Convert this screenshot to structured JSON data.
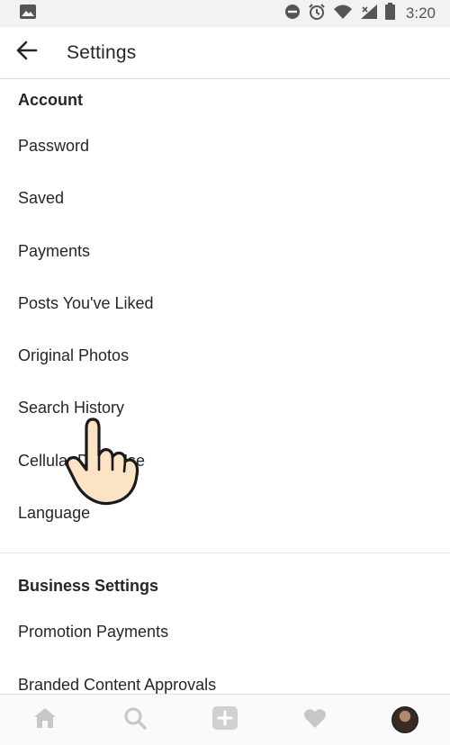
{
  "status_bar": {
    "time": "3:20",
    "icons": [
      "image-icon",
      "do-not-disturb-icon",
      "alarm-icon",
      "wifi-icon",
      "cellular-signal-icon",
      "battery-icon"
    ]
  },
  "header": {
    "title": "Settings",
    "back_icon": "back-arrow-icon"
  },
  "sections": [
    {
      "title": "Account",
      "items": [
        {
          "label": "Password"
        },
        {
          "label": "Saved"
        },
        {
          "label": "Payments"
        },
        {
          "label": "Posts You've Liked"
        },
        {
          "label": "Original Photos"
        },
        {
          "label": "Search History"
        },
        {
          "label": "Cellular Data Use"
        },
        {
          "label": "Language"
        }
      ]
    },
    {
      "title": "Business Settings",
      "items": [
        {
          "label": "Promotion Payments"
        },
        {
          "label": "Branded Content Approvals"
        }
      ]
    }
  ],
  "bottom_nav": {
    "items": [
      "home-icon",
      "search-icon",
      "add-post-icon",
      "activity-heart-icon",
      "profile-avatar"
    ]
  },
  "colors": {
    "text": "#262626",
    "icon_inactive": "#c7c7c7",
    "status_bar_bg": "#f2f2f2",
    "divider": "#dbdbdb"
  }
}
